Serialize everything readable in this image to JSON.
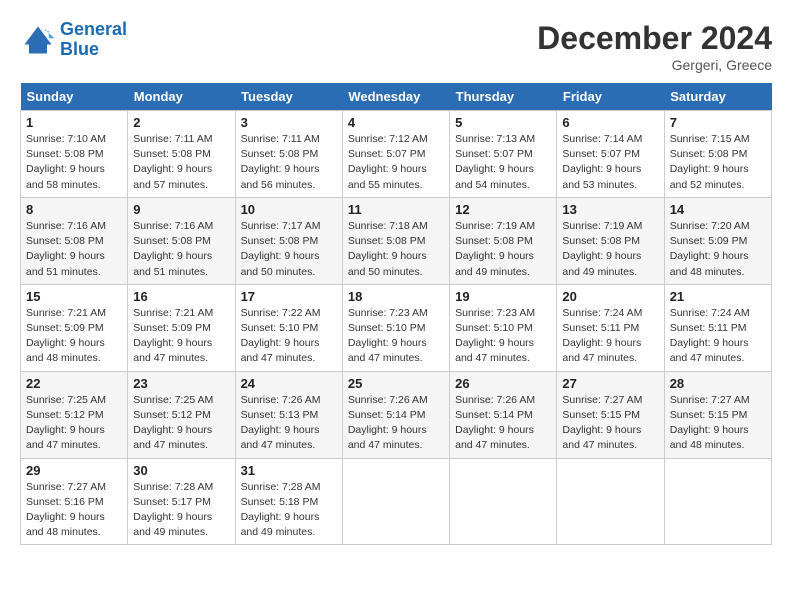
{
  "header": {
    "logo_line1": "General",
    "logo_line2": "Blue",
    "month_year": "December 2024",
    "location": "Gergeri, Greece"
  },
  "days_of_week": [
    "Sunday",
    "Monday",
    "Tuesday",
    "Wednesday",
    "Thursday",
    "Friday",
    "Saturday"
  ],
  "weeks": [
    [
      {
        "day": 1,
        "sunrise": "7:10 AM",
        "sunset": "5:08 PM",
        "daylight": "9 hours and 58 minutes."
      },
      {
        "day": 2,
        "sunrise": "7:11 AM",
        "sunset": "5:08 PM",
        "daylight": "9 hours and 57 minutes."
      },
      {
        "day": 3,
        "sunrise": "7:11 AM",
        "sunset": "5:08 PM",
        "daylight": "9 hours and 56 minutes."
      },
      {
        "day": 4,
        "sunrise": "7:12 AM",
        "sunset": "5:07 PM",
        "daylight": "9 hours and 55 minutes."
      },
      {
        "day": 5,
        "sunrise": "7:13 AM",
        "sunset": "5:07 PM",
        "daylight": "9 hours and 54 minutes."
      },
      {
        "day": 6,
        "sunrise": "7:14 AM",
        "sunset": "5:07 PM",
        "daylight": "9 hours and 53 minutes."
      },
      {
        "day": 7,
        "sunrise": "7:15 AM",
        "sunset": "5:08 PM",
        "daylight": "9 hours and 52 minutes."
      }
    ],
    [
      {
        "day": 8,
        "sunrise": "7:16 AM",
        "sunset": "5:08 PM",
        "daylight": "9 hours and 51 minutes."
      },
      {
        "day": 9,
        "sunrise": "7:16 AM",
        "sunset": "5:08 PM",
        "daylight": "9 hours and 51 minutes."
      },
      {
        "day": 10,
        "sunrise": "7:17 AM",
        "sunset": "5:08 PM",
        "daylight": "9 hours and 50 minutes."
      },
      {
        "day": 11,
        "sunrise": "7:18 AM",
        "sunset": "5:08 PM",
        "daylight": "9 hours and 50 minutes."
      },
      {
        "day": 12,
        "sunrise": "7:19 AM",
        "sunset": "5:08 PM",
        "daylight": "9 hours and 49 minutes."
      },
      {
        "day": 13,
        "sunrise": "7:19 AM",
        "sunset": "5:08 PM",
        "daylight": "9 hours and 49 minutes."
      },
      {
        "day": 14,
        "sunrise": "7:20 AM",
        "sunset": "5:09 PM",
        "daylight": "9 hours and 48 minutes."
      }
    ],
    [
      {
        "day": 15,
        "sunrise": "7:21 AM",
        "sunset": "5:09 PM",
        "daylight": "9 hours and 48 minutes."
      },
      {
        "day": 16,
        "sunrise": "7:21 AM",
        "sunset": "5:09 PM",
        "daylight": "9 hours and 47 minutes."
      },
      {
        "day": 17,
        "sunrise": "7:22 AM",
        "sunset": "5:10 PM",
        "daylight": "9 hours and 47 minutes."
      },
      {
        "day": 18,
        "sunrise": "7:23 AM",
        "sunset": "5:10 PM",
        "daylight": "9 hours and 47 minutes."
      },
      {
        "day": 19,
        "sunrise": "7:23 AM",
        "sunset": "5:10 PM",
        "daylight": "9 hours and 47 minutes."
      },
      {
        "day": 20,
        "sunrise": "7:24 AM",
        "sunset": "5:11 PM",
        "daylight": "9 hours and 47 minutes."
      },
      {
        "day": 21,
        "sunrise": "7:24 AM",
        "sunset": "5:11 PM",
        "daylight": "9 hours and 47 minutes."
      }
    ],
    [
      {
        "day": 22,
        "sunrise": "7:25 AM",
        "sunset": "5:12 PM",
        "daylight": "9 hours and 47 minutes."
      },
      {
        "day": 23,
        "sunrise": "7:25 AM",
        "sunset": "5:12 PM",
        "daylight": "9 hours and 47 minutes."
      },
      {
        "day": 24,
        "sunrise": "7:26 AM",
        "sunset": "5:13 PM",
        "daylight": "9 hours and 47 minutes."
      },
      {
        "day": 25,
        "sunrise": "7:26 AM",
        "sunset": "5:14 PM",
        "daylight": "9 hours and 47 minutes."
      },
      {
        "day": 26,
        "sunrise": "7:26 AM",
        "sunset": "5:14 PM",
        "daylight": "9 hours and 47 minutes."
      },
      {
        "day": 27,
        "sunrise": "7:27 AM",
        "sunset": "5:15 PM",
        "daylight": "9 hours and 47 minutes."
      },
      {
        "day": 28,
        "sunrise": "7:27 AM",
        "sunset": "5:15 PM",
        "daylight": "9 hours and 48 minutes."
      }
    ],
    [
      {
        "day": 29,
        "sunrise": "7:27 AM",
        "sunset": "5:16 PM",
        "daylight": "9 hours and 48 minutes."
      },
      {
        "day": 30,
        "sunrise": "7:28 AM",
        "sunset": "5:17 PM",
        "daylight": "9 hours and 49 minutes."
      },
      {
        "day": 31,
        "sunrise": "7:28 AM",
        "sunset": "5:18 PM",
        "daylight": "9 hours and 49 minutes."
      },
      null,
      null,
      null,
      null
    ]
  ],
  "labels": {
    "sunrise_prefix": "Sunrise: ",
    "sunset_prefix": "Sunset: ",
    "daylight_prefix": "Daylight: "
  }
}
